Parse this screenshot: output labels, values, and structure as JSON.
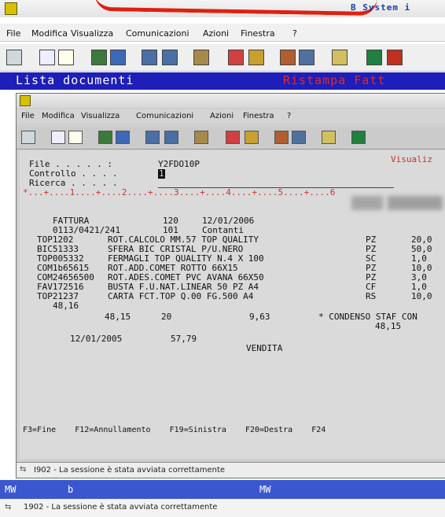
{
  "outer": {
    "system_label": "B  System i",
    "menu": [
      "File",
      "Modifica",
      "Visualizza",
      "Comunicazioni",
      "Azioni",
      "Finestra",
      "?"
    ],
    "band_left": "Lista documenti",
    "band_right": "Ristampa Fatt"
  },
  "inner": {
    "menu": [
      "File",
      "Modifica",
      "Visualizza",
      "Comunicazioni",
      "Azioni",
      "Finestra",
      "?"
    ],
    "screen": {
      "visualizza": "Visualiz",
      "file_label": "File . . . . . :",
      "file_value": "Y2FDO10P",
      "controllo_label": "Controllo . . . .",
      "controllo_value": "1",
      "ricerca_label": "Ricerca . . . . .",
      "ruler": "*...+....1....+....2....+....3....+....4....+....5....+....6",
      "header_left": "FATTURA",
      "header_num": "120",
      "header_date": "12/01/2006",
      "sub_left": "0113/0421/241",
      "sub_num": "101",
      "sub_right": "Contanti",
      "rows": [
        {
          "code": "TOP1202",
          "desc": "ROT.CALCOLO MM.57 TOP QUALITY",
          "um": "PZ",
          "qty": "20,0"
        },
        {
          "code": "BIC51333",
          "desc": "SFERA BIC CRISTAL P/U.NERO",
          "um": "PZ",
          "qty": "50,0"
        },
        {
          "code": "TOP005332",
          "desc": "FERMAGLI TOP QUALITY N.4 X 100",
          "um": "SC",
          "qty": "1,0"
        },
        {
          "code": "COM1b65615",
          "desc": "ROT.ADD.COMET ROTTO 66X15",
          "um": "PZ",
          "qty": "10,0"
        },
        {
          "code": "COM24656500",
          "desc": "ROT.ADES.COMET PVC AVANA 66X50",
          "um": "PZ",
          "qty": "3,0"
        },
        {
          "code": "FAV172516",
          "desc": "BUSTA F.U.NAT.LINEAR 50 PZ A4",
          "um": "CF",
          "qty": "1,0"
        },
        {
          "code": "TOP21237",
          "desc": "CARTA FCT.TOP Q.00 FG.500 A4",
          "um": "RS",
          "qty": "10,0"
        }
      ],
      "total_1": "48,16",
      "t2_a": "48,15",
      "t2_b": "20",
      "t2_c": "9,63",
      "t2_d": "* CONDENSO STAF CON",
      "t3": "48,15",
      "t4_date": "12/01/2005",
      "t4_amt": "57,79",
      "t5": "VENDITA",
      "fkeys": "F3=Fine    F12=Annullamento    F19=Sinistra    F20=Destra    F24"
    },
    "status_text": "I902 - La sessione è stata avviata correttamente"
  },
  "bottom": {
    "band_left": "MW",
    "band_mid": "b",
    "band_right": "MW",
    "status_text": "1902 - La sessione è stata avviata correttamente"
  },
  "colors": {
    "band_blue": "#1e1eb8",
    "red_text": "#e02a2a",
    "bottom_blue": "#3b57d0"
  }
}
